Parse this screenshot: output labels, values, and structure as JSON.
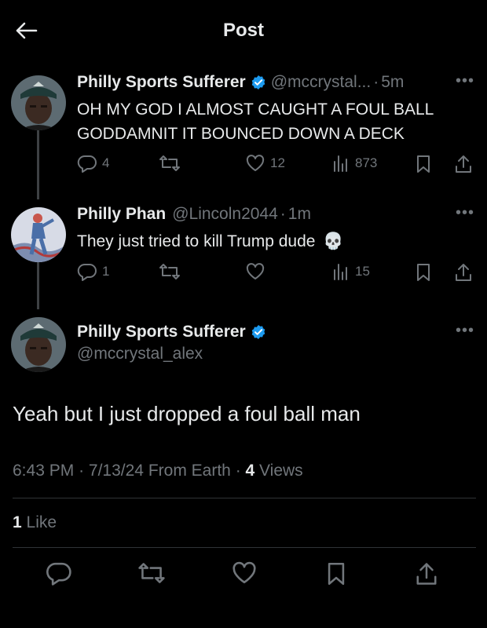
{
  "header": {
    "title": "Post"
  },
  "tweets": [
    {
      "name": "Philly Sports Sufferer",
      "handle": "@mccrystal...",
      "time": "5m",
      "line1": "OH MY GOD I ALMOST CAUGHT A FOUL BALL",
      "line2": "GODDAMNIT IT BOUNCED DOWN A DECK",
      "replies": "4",
      "retweets": "",
      "likes": "12",
      "views": "873"
    },
    {
      "name": "Philly Phan",
      "handle": "@Lincoln2044",
      "time": "1m",
      "text": "They just tried to kill Trump dude",
      "emoji": "💀",
      "replies": "1",
      "retweets": "",
      "likes": "",
      "views": "15"
    }
  ],
  "main": {
    "name": "Philly Sports Sufferer",
    "handle": "@mccrystal_alex",
    "text": "Yeah but I just dropped a foul ball man",
    "time": "6:43 PM",
    "date": "7/13/24",
    "source": "From Earth",
    "views_count": "4",
    "views_label": "Views",
    "likes_count": "1",
    "likes_label": "Like"
  },
  "colors": {
    "verified": "#1d9bf0",
    "muted": "#71767b",
    "text": "#e7e9ea",
    "background": "#000000"
  },
  "icons": [
    "back-arrow-icon",
    "verified-icon",
    "more-icon",
    "reply-icon",
    "retweet-icon",
    "like-icon",
    "views-icon",
    "bookmark-icon",
    "share-icon",
    "skull-emoji"
  ]
}
